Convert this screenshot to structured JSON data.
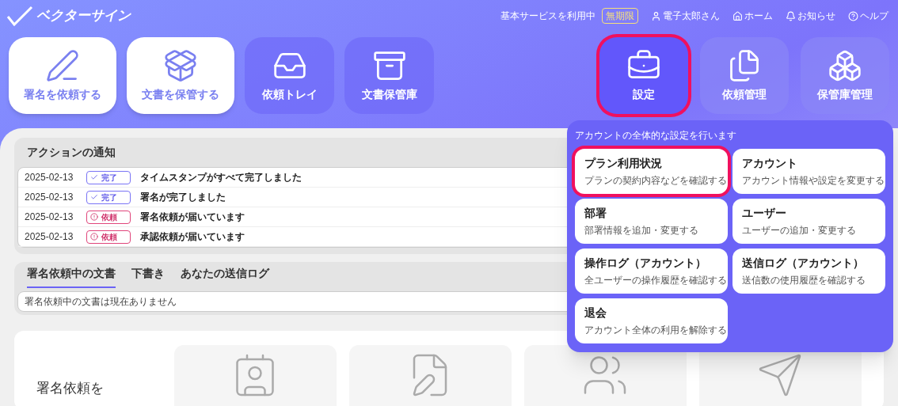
{
  "header": {
    "logo": "ベクターサイン",
    "plan_status": "基本サービスを利用中",
    "plan_badge": "無期限",
    "links": [
      {
        "kind": "user",
        "label": "電子太郎さん"
      },
      {
        "kind": "home",
        "label": "ホーム"
      },
      {
        "kind": "bell",
        "label": "お知らせ"
      },
      {
        "kind": "help",
        "label": "ヘルプ"
      }
    ]
  },
  "nav_tiles": [
    {
      "kind": "action",
      "label": "署名を依頼する",
      "selected": false
    },
    {
      "kind": "action",
      "label": "文書を保管する",
      "selected": false
    },
    {
      "kind": "menu",
      "label": "依頼トレイ",
      "selected": false
    },
    {
      "kind": "menu",
      "label": "文書保管庫",
      "selected": false
    },
    {
      "kind": "admin",
      "label": "設定",
      "selected": true
    },
    {
      "kind": "admin",
      "label": "依頼管理",
      "selected": false
    },
    {
      "kind": "admin",
      "label": "保管庫管理",
      "selected": false
    }
  ],
  "notifications": {
    "title": "アクションの通知",
    "rows": [
      {
        "date": "2025-02-13",
        "badge": {
          "kind": "done",
          "label": "完了"
        },
        "message": "タイムスタンプがすべて完了しました"
      },
      {
        "date": "2025-02-13",
        "badge": {
          "kind": "done",
          "label": "完了"
        },
        "message": "署名が完了しました"
      },
      {
        "date": "2025-02-13",
        "badge": {
          "kind": "request",
          "label": "依頼"
        },
        "message": "署名依頼が届いています"
      },
      {
        "date": "2025-02-13",
        "badge": {
          "kind": "request",
          "label": "依頼"
        },
        "message": "承認依頼が届いています"
      }
    ]
  },
  "documents": {
    "tabs": [
      {
        "label": "署名依頼中の文書",
        "selected": true
      },
      {
        "label": "下書き",
        "selected": false
      },
      {
        "label": "あなたの送信ログ",
        "selected": false
      }
    ],
    "empty_message": "署名依頼中の文書は現在ありません"
  },
  "guide": {
    "heading": "署名依頼を"
  },
  "settings_menu": {
    "description": "アカウントの全体的な設定を行います",
    "items": [
      {
        "title": "プラン利用状況",
        "subtitle": "プランの契約内容などを確認する",
        "selected": true
      },
      {
        "title": "アカウント",
        "subtitle": "アカウント情報や設定を変更する",
        "selected": false
      },
      {
        "title": "部署",
        "subtitle": "部署情報を追加・変更する",
        "selected": false
      },
      {
        "title": "ユーザー",
        "subtitle": "ユーザーの追加・変更する",
        "selected": false
      },
      {
        "title": "操作ログ（アカウント）",
        "subtitle": "全ユーザーの操作履歴を確認する",
        "selected": false
      },
      {
        "title": "送信ログ（アカウント）",
        "subtitle": "送信数の使用履歴を確認する",
        "selected": false
      },
      {
        "title": "退会",
        "subtitle": "アカウント全体の利用を解除する",
        "selected": false
      }
    ]
  }
}
